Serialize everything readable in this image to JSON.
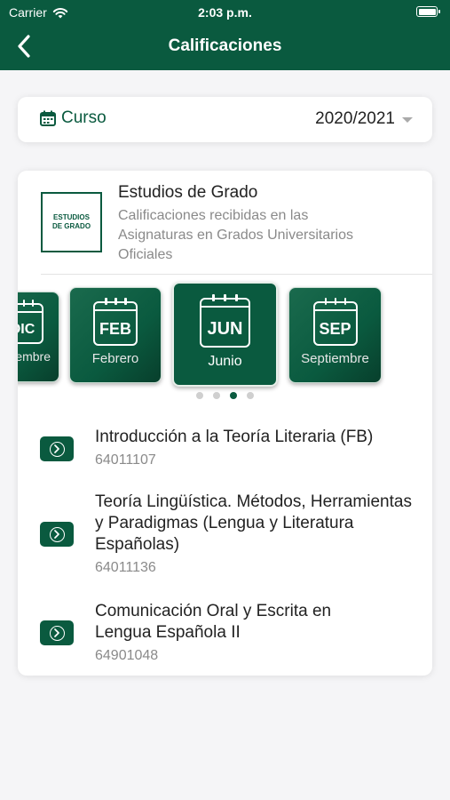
{
  "status_bar": {
    "carrier": "Carrier",
    "time": "2:03 p.m."
  },
  "nav": {
    "title": "Calificaciones",
    "back_icon": "chevron-left-icon"
  },
  "course": {
    "label": "Curso",
    "value": "2020/2021",
    "icon": "calendar-icon"
  },
  "program": {
    "logo_text_line1": "ESTUDIOS",
    "logo_text_line2": "DE GRADO",
    "title": "Estudios de Grado",
    "description": "Calificaciones recibidas en las Asignaturas en Grados Universitarios Oficiales"
  },
  "months": [
    {
      "abbr": "DIC",
      "name": "Diciembre",
      "selected": false
    },
    {
      "abbr": "FEB",
      "name": "Febrero",
      "selected": false
    },
    {
      "abbr": "JUN",
      "name": "Junio",
      "selected": true
    },
    {
      "abbr": "SEP",
      "name": "Septiembre",
      "selected": false
    }
  ],
  "pager": {
    "count": 4,
    "active_index": 2
  },
  "subjects": [
    {
      "name": "Introducción a la Teoría Literaria (FB)",
      "code": "64011107"
    },
    {
      "name": "Teoría Lingüística. Métodos, Herramientas y Paradigmas (Lengua y Literatura Españolas)",
      "code": "64011136"
    },
    {
      "name": "Comunicación Oral y Escrita en Lengua Española II",
      "code": "64901048"
    }
  ],
  "colors": {
    "brand_green": "#0a5a3f",
    "background": "#f5f5f7",
    "muted_text": "#8a8a8a"
  }
}
